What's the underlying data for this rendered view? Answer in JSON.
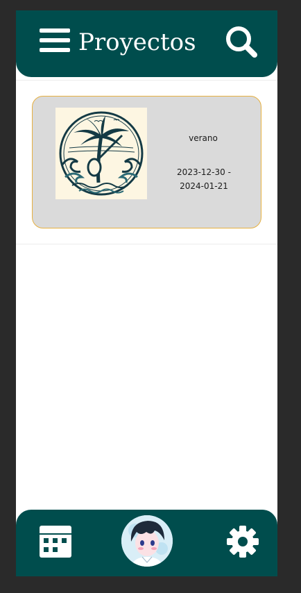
{
  "header": {
    "title": "Proyectos",
    "menu_icon": "menu-icon",
    "search_icon": "search-icon"
  },
  "projects": [
    {
      "name": "verano",
      "dates": "2023-12-30 - 2024-01-21",
      "image": "palm-tree-wave-logo"
    }
  ],
  "footer": {
    "calendar_icon": "calendar-icon",
    "avatar": "user-avatar",
    "settings_icon": "gear-icon"
  },
  "colors": {
    "primary": "#004d4d",
    "card_bg": "#dadada",
    "card_border": "#e6b040",
    "page_bg": "#ffffff"
  }
}
